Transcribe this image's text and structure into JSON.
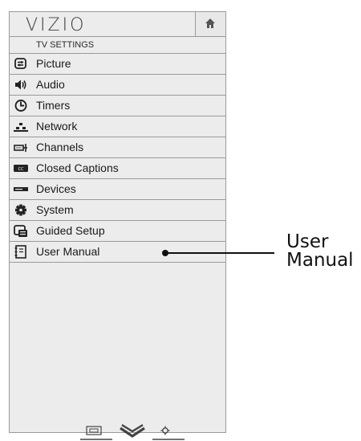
{
  "header": {
    "logo": "VIZIO",
    "home_icon": "home-icon"
  },
  "menu": {
    "title": "TV SETTINGS",
    "items": [
      {
        "label": "Picture",
        "icon": "picture-icon"
      },
      {
        "label": "Audio",
        "icon": "speaker-icon"
      },
      {
        "label": "Timers",
        "icon": "clock-icon"
      },
      {
        "label": "Network",
        "icon": "network-icon"
      },
      {
        "label": "Channels",
        "icon": "antenna-icon"
      },
      {
        "label": "Closed Captions",
        "icon": "cc-icon"
      },
      {
        "label": "Devices",
        "icon": "device-icon"
      },
      {
        "label": "System",
        "icon": "gear-icon"
      },
      {
        "label": "Guided Setup",
        "icon": "guided-setup-icon"
      },
      {
        "label": "User Manual",
        "icon": "manual-icon"
      }
    ]
  },
  "callout": {
    "label_line1": "User",
    "label_line2": "Manual"
  },
  "bottom_bar": {
    "icons": [
      "widescreen-icon",
      "vizio-v-icon",
      "settings-icon"
    ]
  }
}
